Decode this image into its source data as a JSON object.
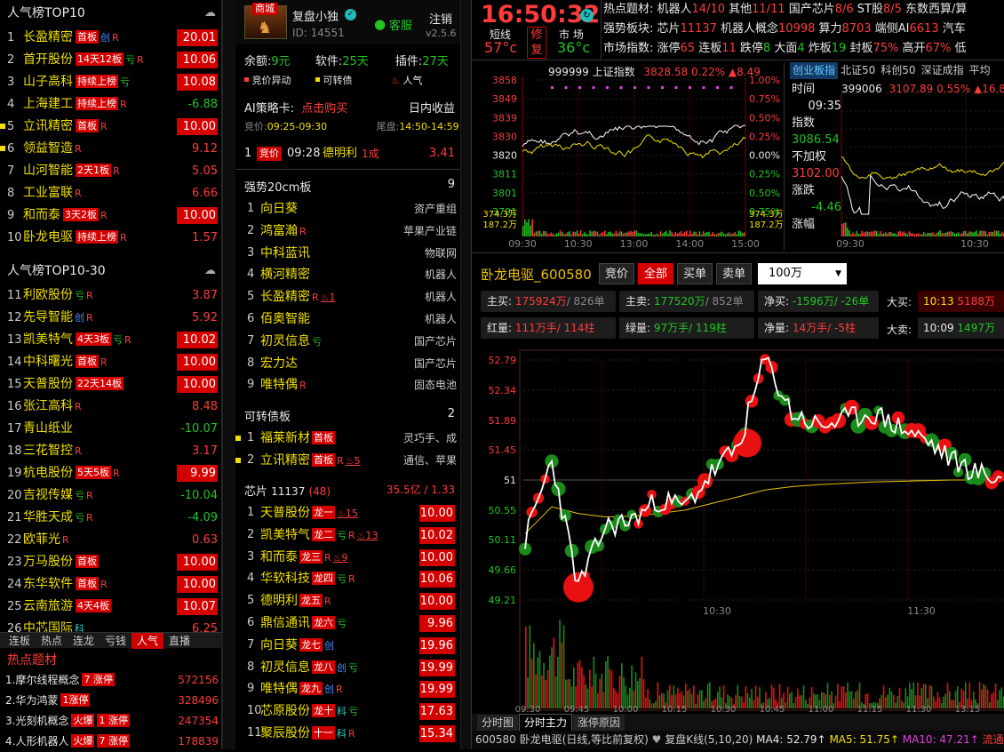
{
  "left": {
    "top10_title": "人气榜TOP10",
    "top10": [
      {
        "idx": "1",
        "name": "长盈精密",
        "tags": [
          "首板"
        ],
        "marks": [
          {
            "t": "创",
            "c": "blu"
          },
          {
            "t": "R",
            "c": "red"
          }
        ],
        "pct": "20.01",
        "box": true,
        "dot": false
      },
      {
        "idx": "2",
        "name": "首开股份",
        "tags": [
          "14天12板"
        ],
        "marks": [
          {
            "t": "亏",
            "c": "grn"
          },
          {
            "t": "R",
            "c": "red"
          }
        ],
        "pct": "10.06",
        "box": true,
        "dot": false
      },
      {
        "idx": "3",
        "name": "山子高科",
        "tags": [
          "持续上榜"
        ],
        "marks": [
          {
            "t": "亏",
            "c": "grn"
          }
        ],
        "pct": "10.08",
        "box": true,
        "dot": false
      },
      {
        "idx": "4",
        "name": "上海建工",
        "tags": [
          "持续上榜"
        ],
        "marks": [
          {
            "t": "R",
            "c": "red"
          }
        ],
        "pct": "-6.88",
        "box": false,
        "dot": false
      },
      {
        "idx": "5",
        "name": "立讯精密",
        "tags": [
          "首板"
        ],
        "marks": [
          {
            "t": "R",
            "c": "red"
          }
        ],
        "pct": "10.00",
        "box": true,
        "dot": true
      },
      {
        "idx": "6",
        "name": "领益智造",
        "tags": [],
        "marks": [
          {
            "t": "R",
            "c": "red"
          }
        ],
        "pct": "9.12",
        "box": false,
        "dot": true
      },
      {
        "idx": "7",
        "name": "山河智能",
        "tags": [
          "2天1板"
        ],
        "marks": [
          {
            "t": "R",
            "c": "red"
          }
        ],
        "pct": "5.05",
        "box": false,
        "dot": false
      },
      {
        "idx": "8",
        "name": "工业富联",
        "tags": [],
        "marks": [
          {
            "t": "R",
            "c": "red"
          }
        ],
        "pct": "6.66",
        "box": false,
        "dot": false
      },
      {
        "idx": "9",
        "name": "和而泰",
        "tags": [
          "3天2板"
        ],
        "marks": [
          {
            "t": "R",
            "c": "red"
          }
        ],
        "pct": "10.00",
        "box": true,
        "dot": false
      },
      {
        "idx": "10",
        "name": "卧龙电驱",
        "tags": [
          "持续上榜"
        ],
        "marks": [
          {
            "t": "R",
            "c": "red"
          }
        ],
        "pct": "1.57",
        "box": false,
        "dot": false
      }
    ],
    "top30_title": "人气榜TOP10-30",
    "top30": [
      {
        "idx": "11",
        "name": "利欧股份",
        "tags": [],
        "marks": [
          {
            "t": "亏",
            "c": "grn"
          },
          {
            "t": "R",
            "c": "red"
          }
        ],
        "pct": "3.87",
        "box": false
      },
      {
        "idx": "12",
        "name": "先导智能",
        "tags": [],
        "marks": [
          {
            "t": "创",
            "c": "blu"
          },
          {
            "t": "R",
            "c": "red"
          }
        ],
        "pct": "5.92",
        "box": false
      },
      {
        "idx": "13",
        "name": "凯美特气",
        "tags": [
          "4天3板"
        ],
        "marks": [
          {
            "t": "亏",
            "c": "grn"
          },
          {
            "t": "R",
            "c": "red"
          }
        ],
        "pct": "10.02",
        "box": true
      },
      {
        "idx": "14",
        "name": "中科曙光",
        "tags": [
          "首板"
        ],
        "marks": [
          {
            "t": "R",
            "c": "red"
          }
        ],
        "pct": "10.00",
        "box": true
      },
      {
        "idx": "15",
        "name": "天普股份",
        "tags": [
          "22天14板"
        ],
        "marks": [],
        "pct": "10.00",
        "box": true
      },
      {
        "idx": "16",
        "name": "张江高科",
        "tags": [],
        "marks": [
          {
            "t": "R",
            "c": "red"
          }
        ],
        "pct": "8.48",
        "box": false
      },
      {
        "idx": "17",
        "name": "青山纸业",
        "tags": [],
        "marks": [],
        "pct": "-10.07",
        "box": false
      },
      {
        "idx": "18",
        "name": "三花智控",
        "tags": [],
        "marks": [
          {
            "t": "R",
            "c": "red"
          }
        ],
        "pct": "3.17",
        "box": false
      },
      {
        "idx": "19",
        "name": "杭电股份",
        "tags": [
          "5天5板"
        ],
        "marks": [
          {
            "t": "R",
            "c": "red"
          }
        ],
        "pct": "9.99",
        "box": true
      },
      {
        "idx": "20",
        "name": "吉视传媒",
        "tags": [],
        "marks": [
          {
            "t": "亏",
            "c": "grn"
          },
          {
            "t": "R",
            "c": "red"
          }
        ],
        "pct": "-10.04",
        "box": false
      },
      {
        "idx": "21",
        "name": "华胜天成",
        "tags": [],
        "marks": [
          {
            "t": "亏",
            "c": "grn"
          },
          {
            "t": "R",
            "c": "red"
          }
        ],
        "pct": "-4.09",
        "box": false
      },
      {
        "idx": "22",
        "name": "欧菲光",
        "tags": [],
        "marks": [
          {
            "t": "R",
            "c": "red"
          }
        ],
        "pct": "0.63",
        "box": false
      },
      {
        "idx": "23",
        "name": "万马股份",
        "tags": [
          "首板"
        ],
        "marks": [],
        "pct": "10.00",
        "box": true
      },
      {
        "idx": "24",
        "name": "东华软件",
        "tags": [
          "首板"
        ],
        "marks": [
          {
            "t": "R",
            "c": "red"
          }
        ],
        "pct": "10.00",
        "box": true
      },
      {
        "idx": "25",
        "name": "云南旅游",
        "tags": [
          "4天4板"
        ],
        "marks": [],
        "pct": "10.07",
        "box": true
      },
      {
        "idx": "26",
        "name": "中芯国际",
        "tags": [],
        "marks": [
          {
            "t": "科",
            "c": "cyn"
          }
        ],
        "pct": "6.25",
        "box": false
      }
    ],
    "tabs": [
      "连板",
      "热点",
      "连龙",
      "亏钱",
      "人气",
      "直播"
    ],
    "active_tab": "人气",
    "hot_title": "热点题材",
    "hot": [
      {
        "name": "1.摩尔线程概念",
        "tags": [
          "7 涨停"
        ],
        "val": "572156"
      },
      {
        "name": "2.华为鸿蒙",
        "tags": [
          "1涨停"
        ],
        "val": "328496"
      },
      {
        "name": "3.光刻机概念",
        "tags": [
          "火爆",
          "1 涨停"
        ],
        "val": "247354"
      },
      {
        "name": "4.人形机器人",
        "tags": [
          "火爆",
          "7 涨停"
        ],
        "val": "178839"
      }
    ]
  },
  "mid": {
    "badge": "商城",
    "user": "复盘小独",
    "id": "ID: 14551",
    "service": "客服",
    "logout": "注销",
    "version": "v2.5.6",
    "balance_label": "余额:",
    "balance": "9元",
    "software_label": "软件:",
    "software": "25天",
    "plugin_label": "插件:",
    "plugin": "27天",
    "flags": [
      "竞价异动",
      "可转债",
      "人气"
    ],
    "ai_title": "AI策略卡:",
    "ai_buy": "点击购买",
    "ai_mode": "日内收益",
    "ai_jj_label": "竞价:",
    "ai_jj": "09:25-09:30",
    "ai_wp_label": "尾盘:",
    "ai_wp": "14:50-14:59",
    "ai_row": {
      "idx": "1",
      "tag": "竞价",
      "time": "09:28",
      "name": "德明利",
      "sub": "1成",
      "val": "3.41"
    },
    "g1_title": "强势20cm板",
    "g1_count": "9",
    "g1": [
      {
        "idx": "1",
        "name": "向日葵",
        "marks": [],
        "cat": "资产重组"
      },
      {
        "idx": "2",
        "name": "鸿富瀚",
        "marks": [
          "R"
        ],
        "cat": "苹果产业链"
      },
      {
        "idx": "3",
        "name": "中科蓝讯",
        "marks": [],
        "cat": "物联网"
      },
      {
        "idx": "4",
        "name": "横河精密",
        "marks": [],
        "cat": "机器人"
      },
      {
        "idx": "5",
        "name": "长盈精密",
        "marks": [
          "R",
          "♨1"
        ],
        "cat": "机器人"
      },
      {
        "idx": "6",
        "name": "佰奥智能",
        "marks": [],
        "cat": "机器人"
      },
      {
        "idx": "7",
        "name": "初灵信息",
        "marks": [
          "亏"
        ],
        "cat": "国产芯片"
      },
      {
        "idx": "8",
        "name": "宏力达",
        "marks": [],
        "cat": "国产芯片"
      },
      {
        "idx": "9",
        "name": "唯特偶",
        "marks": [
          "R"
        ],
        "cat": "固态电池"
      }
    ],
    "g2_title": "可转债板",
    "g2_count": "2",
    "g2": [
      {
        "idx": "1",
        "name": "福莱新材",
        "tag": "首板",
        "marks": [],
        "cat": "灵巧手、成"
      },
      {
        "idx": "2",
        "name": "立讯精密",
        "tag": "首板",
        "marks": [
          "R",
          "♨5"
        ],
        "cat": "通信、苹果"
      }
    ],
    "g3_title": "芯片",
    "g3_num": "11137",
    "g3_cnt": "(48)",
    "g3_amt": "35.5亿",
    "g3_ratio": "/ 1.33",
    "g3": [
      {
        "idx": "1",
        "name": "天普股份",
        "tag": "龙一",
        "marks": [
          "♨15"
        ],
        "pct": "10.00"
      },
      {
        "idx": "2",
        "name": "凯美特气",
        "tag": "龙二",
        "marks": [
          "亏",
          "R",
          "♨13"
        ],
        "pct": "10.02"
      },
      {
        "idx": "3",
        "name": "和而泰",
        "tag": "龙三",
        "marks": [
          "R",
          "♨9"
        ],
        "pct": "10.00"
      },
      {
        "idx": "4",
        "name": "华软科技",
        "tag": "龙四",
        "marks": [
          "亏",
          "R"
        ],
        "pct": "10.06"
      },
      {
        "idx": "5",
        "name": "德明利",
        "tag": "龙五",
        "marks": [
          "R"
        ],
        "pct": "10.00"
      },
      {
        "idx": "6",
        "name": "鼎信通讯",
        "tag": "龙六",
        "marks": [
          "亏"
        ],
        "pct": "9.96"
      },
      {
        "idx": "7",
        "name": "向日葵",
        "tag": "龙七",
        "marks": [
          "创"
        ],
        "pct": "19.96"
      },
      {
        "idx": "8",
        "name": "初灵信息",
        "tag": "龙八",
        "marks": [
          "创",
          "亏"
        ],
        "pct": "19.99"
      },
      {
        "idx": "9",
        "name": "唯特偶",
        "tag": "龙九",
        "marks": [
          "创",
          "R"
        ],
        "pct": "19.99"
      },
      {
        "idx": "10",
        "name": "芯原股份",
        "tag": "龙十",
        "marks": [
          "科",
          "亏"
        ],
        "pct": "17.63"
      },
      {
        "idx": "11",
        "name": "聚辰股份",
        "tag": "十一",
        "marks": [
          "科",
          "R"
        ],
        "pct": "15.34"
      }
    ]
  },
  "right": {
    "clock": "16:50:32",
    "temp1_label": "短线",
    "temp1": "57°c",
    "review_top": "修",
    "review_bot": "复",
    "temp2_label": "市 场",
    "temp2": "36°c",
    "info1": [
      {
        "t": "热点题材:",
        "c": "wht"
      },
      {
        "t": " 机器人",
        "c": "wht"
      },
      {
        "t": "14/10",
        "c": "red"
      },
      {
        "t": " 其他",
        "c": "wht"
      },
      {
        "t": "11/11",
        "c": "red"
      },
      {
        "t": " 国产芯片",
        "c": "wht"
      },
      {
        "t": "8/6",
        "c": "red"
      },
      {
        "t": " ST股",
        "c": "wht"
      },
      {
        "t": "8/5",
        "c": "red"
      },
      {
        "t": " 东数西算/算",
        "c": "wht"
      }
    ],
    "info2": [
      {
        "t": "强势板块:",
        "c": "wht"
      },
      {
        "t": " 芯片",
        "c": "wht"
      },
      {
        "t": "11137",
        "c": "red"
      },
      {
        "t": " 机器人概念",
        "c": "wht"
      },
      {
        "t": "10998",
        "c": "red"
      },
      {
        "t": " 算力",
        "c": "wht"
      },
      {
        "t": "8703",
        "c": "red"
      },
      {
        "t": " 端侧AI",
        "c": "wht"
      },
      {
        "t": "6613",
        "c": "red"
      },
      {
        "t": " 汽车",
        "c": "wht"
      }
    ],
    "info3": [
      {
        "t": "市场指数:",
        "c": "wht"
      },
      {
        "t": " 涨停",
        "c": "wht"
      },
      {
        "t": "65",
        "c": "red"
      },
      {
        "t": " 连板",
        "c": "wht"
      },
      {
        "t": "11",
        "c": "red"
      },
      {
        "t": " 跌停",
        "c": "wht"
      },
      {
        "t": "8",
        "c": "grn"
      },
      {
        "t": " 大面",
        "c": "wht"
      },
      {
        "t": "4",
        "c": "grn"
      },
      {
        "t": " 炸板",
        "c": "wht"
      },
      {
        "t": "19",
        "c": "grn"
      },
      {
        "t": " 封板",
        "c": "wht"
      },
      {
        "t": "75%",
        "c": "red"
      },
      {
        "t": " 高开",
        "c": "wht"
      },
      {
        "t": "67%",
        "c": "red"
      },
      {
        "t": " 低",
        "c": "wht"
      }
    ],
    "idx1": {
      "code": "999999",
      "name": "上证指数",
      "price": "3828.58",
      "pct": "0.22%",
      "chg": "▲8.49"
    },
    "idx1_left_ticks": [
      "3858",
      "3849",
      "3839",
      "3830",
      "3820",
      "3811",
      "3801",
      "3791"
    ],
    "idx1_right_ticks": [
      "1.00%",
      "0.75%",
      "0.50%",
      "0.25%",
      "0.00%",
      "0.25%",
      "0.50%",
      "0.75%"
    ],
    "idx1_vol_ticks": [
      "374.3万",
      "187.2万"
    ],
    "idx1_time_ticks": [
      "09:30",
      "10:30",
      "13:00",
      "14:00",
      "15:00"
    ],
    "idx_tabs": [
      "创业板指",
      "北证50",
      "科创50",
      "深证成指",
      "平均"
    ],
    "idx_tab_active": "创业板指",
    "idx2": {
      "code": "399006",
      "price": "3107.89",
      "pct": "0.55%",
      "chg": "▲16.89"
    },
    "idx2_side": {
      "time_label": "时间",
      "time": "09:35",
      "zs_label": "指数",
      "zs": "3086.54",
      "bjq_label": "不加权",
      "bjq": "3102.00",
      "zd_label": "涨跌",
      "zd": "-4.46",
      "zf_label": "涨幅"
    },
    "idx2_time_ticks": [
      "09:30",
      "10:30"
    ],
    "stock_title": "卧龙电驱_600580",
    "btns": [
      "竞价",
      "全部",
      "买单",
      "卖单"
    ],
    "btn_active": "全部",
    "select_value": "100万",
    "stats": {
      "zm_label": "主买:",
      "zm": "175924万",
      "zm_n": "/ 826单",
      "zs_label": "主卖:",
      "zs": "177520万",
      "zs_n": "/ 852单",
      "jm_label": "净买:",
      "jm": "-1596万",
      "jm_n": "/ -26单",
      "db_label": "大买:",
      "db_t": "10:13",
      "db_v": "5188万",
      "hl_label": "红量:",
      "hl": "111万手",
      "hl_n": "/ 114柱",
      "gl_label": "绿量:",
      "gl": "97万手",
      "gl_n": "/ 119柱",
      "jl_label": "净量:",
      "jl": "14万手",
      "jl_n": "/ -5柱",
      "dm_label": "大卖:",
      "dm_t": "10:09",
      "dm_v": "1497万"
    },
    "price_ticks": [
      "52.79",
      "52.34",
      "51.89",
      "51.45",
      "51",
      "50.55",
      "50.11",
      "49.66",
      "49.21"
    ],
    "price_time_ticks": [
      "10:30",
      "11:30"
    ],
    "vol_time_ticks": [
      "09:30",
      "09:45",
      "10:00",
      "10:15",
      "10:30",
      "10:45",
      "11:00",
      "11:15",
      "11:30",
      "13:15"
    ],
    "bottom_tabs": [
      "分时图",
      "分时主力",
      "涨停原因"
    ],
    "bottom_tab_active": "分时主力",
    "status": {
      "code": "600580",
      "name": "卧龙电驱",
      "desc": "(日线,等比前复权)",
      "kline": "复盘K线(5,10,20)",
      "ma4": "MA4: 52.79↑",
      "ma5": "MA5: 51.75↑",
      "ma10": "MA10: 47.21↑",
      "flow": "流通"
    }
  },
  "chart_data": [
    {
      "type": "line",
      "title": "上证指数",
      "x_range": [
        "09:30",
        "15:00"
      ],
      "ylim": [
        3791,
        3858
      ],
      "series": [],
      "volume_ticks": [
        "374.3万",
        "187.2万"
      ]
    },
    {
      "type": "line",
      "title": "399006",
      "x_range": [
        "09:30",
        "10:30"
      ],
      "series": []
    },
    {
      "type": "line",
      "title": "卧龙电驱_600580",
      "ylim": [
        49.21,
        52.79
      ],
      "x": [
        "09:30",
        "09:35",
        "09:40",
        "09:45",
        "09:50",
        "09:55",
        "10:00",
        "10:05",
        "10:10",
        "10:15",
        "10:20",
        "10:25",
        "10:30",
        "10:40",
        "10:50",
        "11:00",
        "11:10",
        "11:20",
        "11:30"
      ],
      "series": [
        {
          "values": [
            50.1,
            51.3,
            49.4,
            50.3,
            50.4,
            50.7,
            50.6,
            51.1,
            51.5,
            52.8,
            52.0,
            51.8,
            51.9,
            52.0,
            51.8,
            51.6,
            51.3,
            51.1,
            51.0
          ]
        },
        {
          "values": [
            50.2,
            50.6,
            50.5,
            50.45,
            50.46,
            50.5,
            50.55,
            50.65,
            50.75,
            50.85,
            50.9,
            50.93,
            50.95,
            50.97,
            50.98,
            50.99,
            51.0,
            51.0,
            51.0
          ]
        }
      ]
    }
  ]
}
